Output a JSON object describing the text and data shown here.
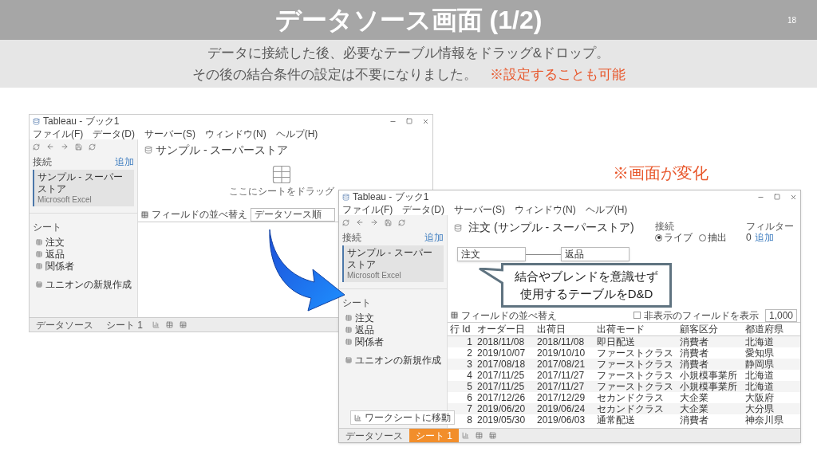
{
  "slide": {
    "title": "データソース画面 (1/2)",
    "page_number": "18",
    "lines": [
      "データに接続した後、必要なテーブル情報をドラッグ&ドロップ。",
      "その後の結合条件の設定は不要になりました。"
    ],
    "note": "※設定することも可能",
    "change_note": "※画面が変化",
    "callout": [
      "結合やブレンドを意識せず",
      "使用するテーブルをD&D"
    ]
  },
  "window_before": {
    "title": "Tableau - ブック1",
    "menu": [
      "ファイル(F)",
      "データ(D)",
      "サーバー(S)",
      "ウィンドウ(N)",
      "ヘルプ(H)"
    ],
    "connections_label": "接続",
    "add_link": "追加",
    "connection": "サンプル - スーパーストア",
    "connection_type": "Microsoft Excel",
    "sheets_label": "シート",
    "sheets": [
      "注文",
      "返品",
      "関係者"
    ],
    "new_union": "ユニオンの新規作成",
    "heading": "サンプル - スーパーストア",
    "drop_hint": "ここにシートをドラッグ",
    "sort_label": "フィールドの並べ替え",
    "sort_value": "データソース順",
    "tabs": [
      {
        "label": "データソース",
        "selected": false
      },
      {
        "label": "シート 1",
        "selected": false
      }
    ]
  },
  "window_after": {
    "title": "Tableau - ブック1",
    "menu": [
      "ファイル(F)",
      "データ(D)",
      "サーバー(S)",
      "ウィンドウ(N)",
      "ヘルプ(H)"
    ],
    "connections_label": "接続",
    "add_link": "追加",
    "connection": "サンプル - スーパーストア",
    "connection_type": "Microsoft Excel",
    "sheets_label": "シート",
    "sheets": [
      "注文",
      "返品",
      "関係者"
    ],
    "new_union": "ユニオンの新規作成",
    "heading": "注文 (サンプル - スーパーストア)",
    "connection_mode_label": "接続",
    "modes": [
      {
        "label": "ライブ",
        "selected": true
      },
      {
        "label": "抽出",
        "selected": false
      }
    ],
    "filter_label": "フィルター",
    "filter_count": "0",
    "filter_add": "追加",
    "tables": [
      "注文",
      "返品"
    ],
    "sort_label": "フィールドの並べ替え",
    "show_hidden": "非表示のフィールドを表示",
    "show_hidden_checked": false,
    "row_count": "1,000",
    "columns": [
      "行 Id",
      "オーダー日",
      "出荷日",
      "出荷モード",
      "顧客区分",
      "都道府県"
    ],
    "rows": [
      [
        "1",
        "2018/11/08",
        "2018/11/08",
        "即日配送",
        "消費者",
        "北海道"
      ],
      [
        "2",
        "2019/10/07",
        "2019/10/10",
        "ファーストクラス",
        "消費者",
        "愛知県"
      ],
      [
        "3",
        "2017/08/18",
        "2017/08/21",
        "ファーストクラス",
        "消費者",
        "静岡県"
      ],
      [
        "4",
        "2017/11/25",
        "2017/11/27",
        "ファーストクラス",
        "小規模事業所",
        "北海道"
      ],
      [
        "5",
        "2017/11/25",
        "2017/11/27",
        "ファーストクラス",
        "小規模事業所",
        "北海道"
      ],
      [
        "6",
        "2017/12/26",
        "2017/12/29",
        "セカンドクラス",
        "大企業",
        "大阪府"
      ],
      [
        "7",
        "2019/06/20",
        "2019/06/24",
        "セカンドクラス",
        "大企業",
        "大分県"
      ],
      [
        "8",
        "2019/05/30",
        "2019/06/03",
        "通常配送",
        "消費者",
        "神奈川県"
      ]
    ],
    "go_to_sheet": "ワークシートに移動",
    "tabs": [
      {
        "label": "データソース",
        "selected": false
      },
      {
        "label": "シート 1",
        "selected": true
      }
    ]
  }
}
